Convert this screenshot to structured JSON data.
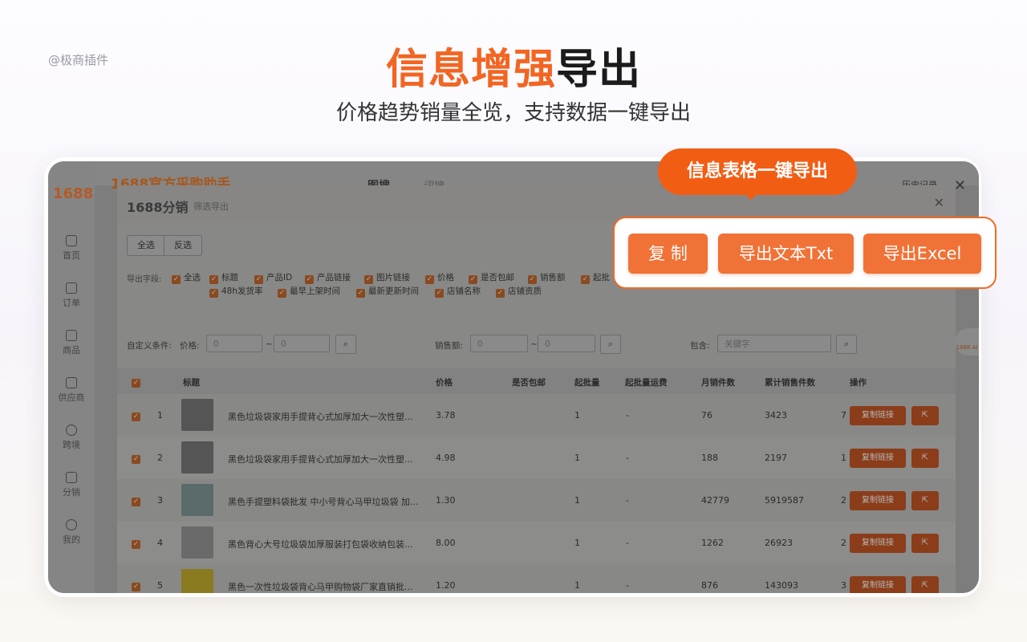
{
  "watermark": "@极商插件",
  "hero": {
    "title_highlight": "信息增强",
    "title_dark": "导出",
    "subtitle": "价格趋势销量全览，支持数据一键导出"
  },
  "app": {
    "logo": "1688",
    "brand": "1688官方采购助手",
    "tabs": [
      "图搜",
      "词搜"
    ],
    "history": "历史记录",
    "nav": [
      "首页",
      "订单",
      "商品",
      "供应商",
      "跨境",
      "分销",
      "我的"
    ],
    "side_badge": "1688 AI"
  },
  "modal": {
    "title": "1688分销",
    "subtitle": "筛选导出",
    "select_all": "全选",
    "invert": "反选",
    "fields_label": "导出字段:",
    "fields_row1": [
      "全选",
      "标题",
      "产品ID",
      "产品链接",
      "图片链接",
      "价格",
      "是否包邮",
      "销售额",
      "起批"
    ],
    "fields_row2": [
      "48h发货率",
      "最早上架时间",
      "最新更新时间",
      "店铺名称",
      "店铺资质"
    ],
    "condition_label": "自定义条件:",
    "price_label": "价格:",
    "sales_label": "销售额:",
    "contains_label": "包含:",
    "min_placeholder": "0",
    "max_placeholder": "0",
    "keyword_placeholder": "关键字",
    "range_sep": "~",
    "columns": [
      "标题",
      "价格",
      "是否包邮",
      "起批量",
      "起批量运费",
      "月销件数",
      "累计销售件数",
      "操作"
    ],
    "rows": [
      {
        "no": "1",
        "title": "黑色垃圾袋家用手提背心式加厚加大一次性塑...",
        "price": "3.78",
        "moq": "1",
        "fee": "-",
        "monthly": "76",
        "total": "3423",
        "extra": "7"
      },
      {
        "no": "2",
        "title": "黑色垃圾袋家用手提背心式加厚加大一次性塑...",
        "price": "4.98",
        "moq": "1",
        "fee": "-",
        "monthly": "188",
        "total": "2197",
        "extra": "1"
      },
      {
        "no": "3",
        "title": "黑色手提塑料袋批发 中小号背心马甲垃圾袋 加...",
        "price": "1.30",
        "moq": "1",
        "fee": "-",
        "monthly": "42779",
        "total": "5919587",
        "extra": "2"
      },
      {
        "no": "4",
        "title": "黑色背心大号垃圾袋加厚服装打包袋收纳包装...",
        "price": "8.00",
        "moq": "1",
        "fee": "-",
        "monthly": "1262",
        "total": "26923",
        "extra": "2"
      },
      {
        "no": "5",
        "title": "黑色一次性垃圾袋背心马甲购物袋厂家直销批...",
        "price": "1.20",
        "moq": "1",
        "fee": "-",
        "monthly": "876",
        "total": "143093",
        "extra": "3"
      }
    ],
    "copy_link": "复制链接"
  },
  "callout": {
    "bubble": "信息表格一键导出",
    "copy": "复 制",
    "export_txt": "导出文本Txt",
    "export_excel": "导出Excel"
  },
  "colors": {
    "accent": "#f26522",
    "button": "#f07236"
  }
}
